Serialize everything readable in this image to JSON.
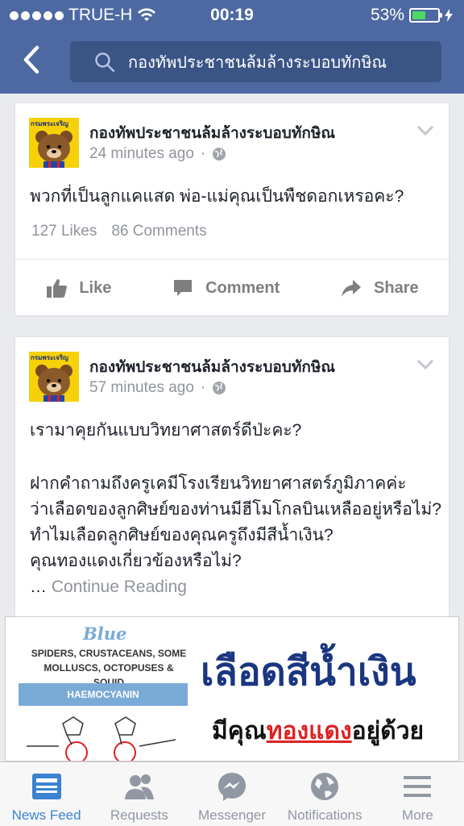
{
  "status_bar": {
    "carrier": "TRUE-H",
    "time": "00:19",
    "battery": "53%",
    "battery_level": 0.53
  },
  "search": {
    "query": "กองทัพประชาชนล้มล้างระบอบทักษิณ"
  },
  "posts": [
    {
      "author": "กองทัพประชาชนล้มล้างระบอบทักษิณ",
      "avatar_tag": "กรมพระเจริญ",
      "time": "24 minutes ago",
      "text": "พวกที่เป็นลูกแคแสด พ่อ-แม่คุณเป็นพืชดอกเหรอคะ?",
      "likes": "127 Likes",
      "comments": "86 Comments",
      "actions": [
        "Like",
        "Comment",
        "Share"
      ]
    },
    {
      "author": "กองทัพประชาชนล้มล้างระบอบทักษิณ",
      "avatar_tag": "กรมพระเจริญ",
      "time": "57 minutes ago",
      "lines": [
        "เรามาคุยกันแบบวิทยาศาสตร์ดีป่ะคะ?",
        "",
        "ฝากคำถามถึงครูเคมีโรงเรียนวิทยาศาสตร์ภูมิภาคค่ะ",
        "ว่าเลือดของลูกศิษย์ของท่านมีฮีโมโกลบินเหลืออยู่หรือไม่?",
        "ทำไมเลือดลูกศิษย์ของคุณครูถึงมีสีน้ำเงิน?",
        "คุณทองแดงเกี่ยวข้องหรือไม่?"
      ],
      "ellipsis": "…",
      "continue": "Continue Reading"
    }
  ],
  "ad_image": {
    "title": "Blue",
    "subtitle_line1": "SPIDERS, CRUSTACEANS, SOME",
    "subtitle_line2": "MOLLUSCS, OCTOPUSES & SQUID",
    "label": "HAEMOCYANIN",
    "headline": "เลือดสีน้ำเงิน",
    "sub_prefix": "มีคุณ",
    "sub_red": "ทองแดง",
    "sub_suffix": "อยู่ด้วย"
  },
  "tabs": [
    {
      "label": "News Feed",
      "icon": "news-feed-icon",
      "active": true
    },
    {
      "label": "Requests",
      "icon": "requests-icon"
    },
    {
      "label": "Messenger",
      "icon": "messenger-icon"
    },
    {
      "label": "Notifications",
      "icon": "notifications-icon"
    },
    {
      "label": "More",
      "icon": "more-icon"
    }
  ],
  "colors": {
    "brand": "#4e69a2",
    "active_tab": "#3b83d1"
  }
}
